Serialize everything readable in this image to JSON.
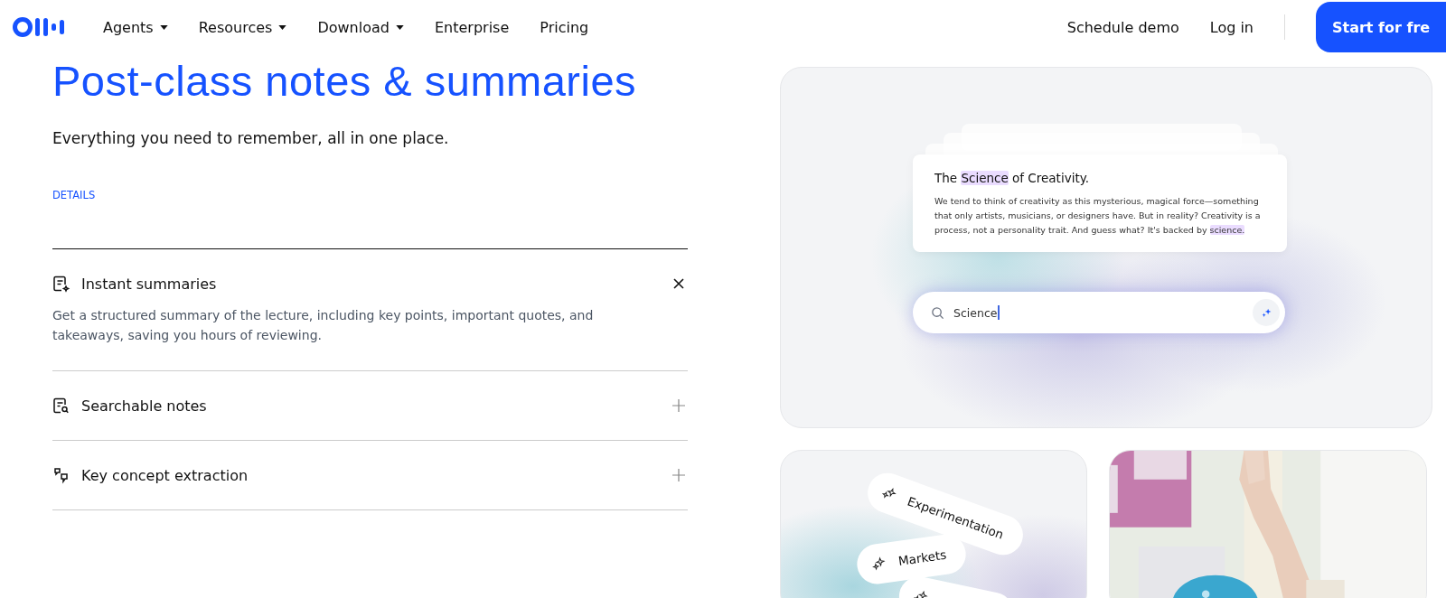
{
  "nav": {
    "links": [
      {
        "label": "Agents",
        "dropdown": true
      },
      {
        "label": "Resources",
        "dropdown": true
      },
      {
        "label": "Download",
        "dropdown": true
      },
      {
        "label": "Enterprise",
        "dropdown": false
      },
      {
        "label": "Pricing",
        "dropdown": false
      }
    ],
    "right_links": [
      "Schedule demo",
      "Log in"
    ],
    "cta": "Start for fre"
  },
  "hero": {
    "heading": "Post-class notes & summaries",
    "subtitle": "Everything you need to remember, all in one place.",
    "details_label": "DETAILS"
  },
  "features": [
    {
      "title": "Instant summaries",
      "expanded": true,
      "description": "Get a structured summary of the lecture, including key points, important quotes, and takeaways, saving you hours of reviewing."
    },
    {
      "title": "Searchable notes",
      "expanded": false
    },
    {
      "title": "Key concept extraction",
      "expanded": false
    }
  ],
  "preview": {
    "doc_title": "The **Science** of Creativity.",
    "doc_body": "We tend to think of creativity as this mysterious, magical force—something that only artists, musicians, or designers have. But in reality? Creativity is a process, not a personality trait. And guess what? It's backed by **science.**",
    "search_value": "Science"
  },
  "tags": [
    "Experimentation",
    "Markets"
  ],
  "photo": {
    "kind": "picture"
  }
}
